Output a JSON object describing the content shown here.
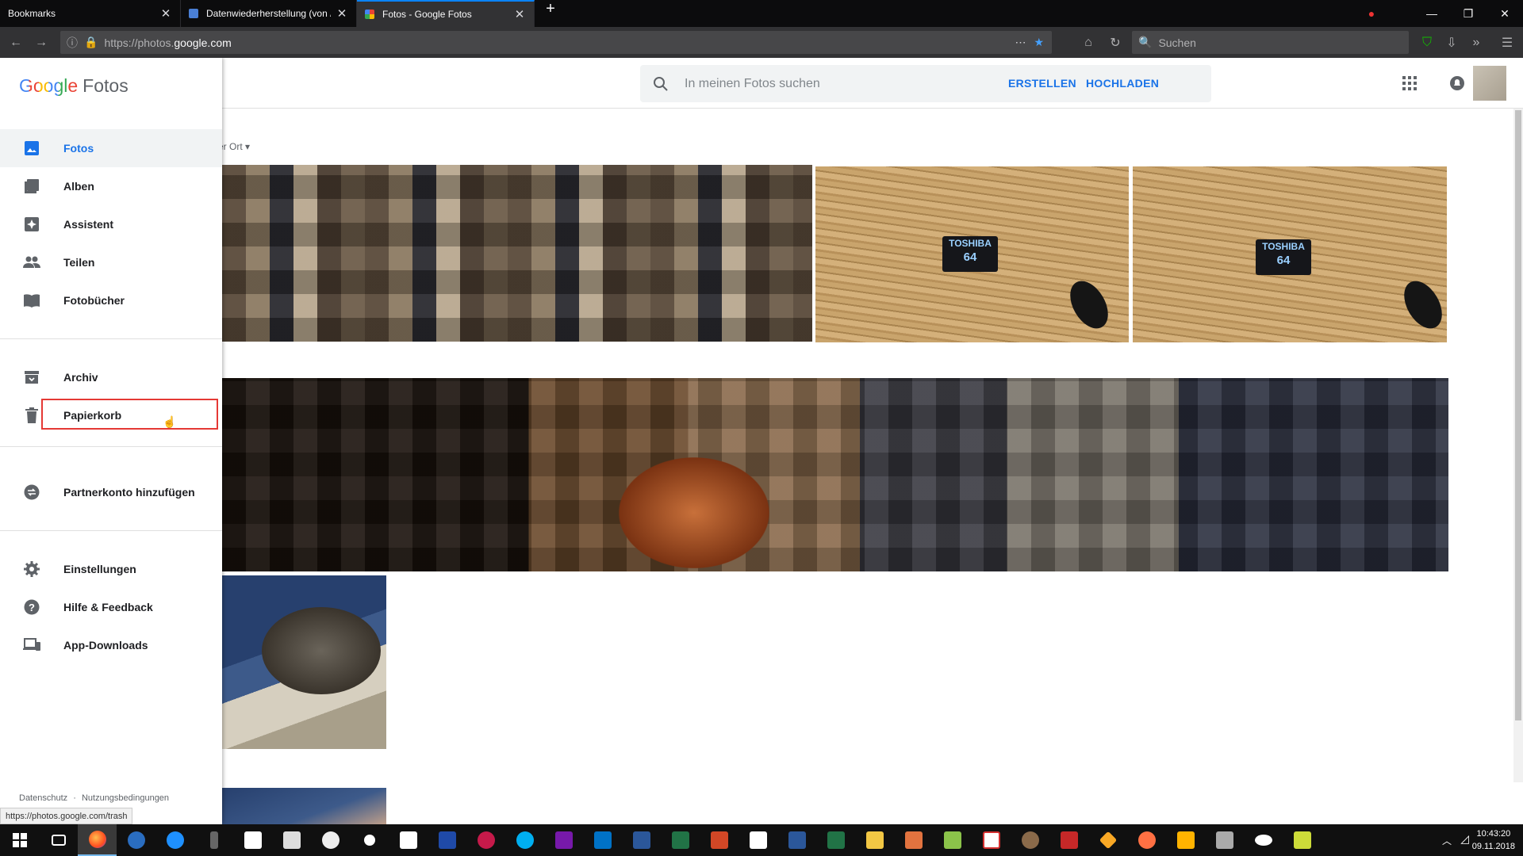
{
  "browser": {
    "tabs": [
      {
        "title": "Bookmarks",
        "active": false
      },
      {
        "title": "Datenwiederherstellung (von /",
        "active": false
      },
      {
        "title": "Fotos - Google Fotos",
        "active": true
      }
    ],
    "url_prefix": "https://photos.",
    "url_domain": "google.com",
    "search_placeholder": "Suchen",
    "overflow_glyph": "⋯"
  },
  "app": {
    "logo_google": "Google",
    "logo_fotos": "Fotos",
    "search_placeholder": "In meinen Fotos suchen",
    "create_label": "ERSTELLEN",
    "upload_label": "HOCHLADEN",
    "filter_text": "er Ort ▾"
  },
  "sidebar": {
    "items": [
      {
        "label": "Fotos",
        "icon": "photo-icon",
        "selected": true
      },
      {
        "label": "Alben",
        "icon": "albums-icon"
      },
      {
        "label": "Assistent",
        "icon": "assistant-icon"
      },
      {
        "label": "Teilen",
        "icon": "people-icon"
      },
      {
        "label": "Fotobücher",
        "icon": "book-icon"
      },
      {
        "label": "Archiv",
        "icon": "archive-icon"
      },
      {
        "label": "Papierkorb",
        "icon": "trash-icon",
        "highlighted": true
      },
      {
        "label": "Partnerkonto hinzufügen",
        "icon": "partner-icon"
      },
      {
        "label": "Einstellungen",
        "icon": "gear-icon"
      },
      {
        "label": "Hilfe & Feedback",
        "icon": "help-icon"
      },
      {
        "label": "App-Downloads",
        "icon": "devices-icon"
      }
    ],
    "footer_privacy": "Datenschutz",
    "footer_sep": "·",
    "footer_terms": "Nutzungsbedingungen"
  },
  "photos": {
    "card_brand": "TOSHIBA",
    "card_size": "64"
  },
  "status_url": "https://photos.google.com/trash",
  "clock": {
    "time": "10:43:20",
    "date": "09.11.2018"
  },
  "colors": {
    "accent": "#1a73e8",
    "highlight_box": "#e53935",
    "firefox_dark": "#0c0c0d"
  }
}
